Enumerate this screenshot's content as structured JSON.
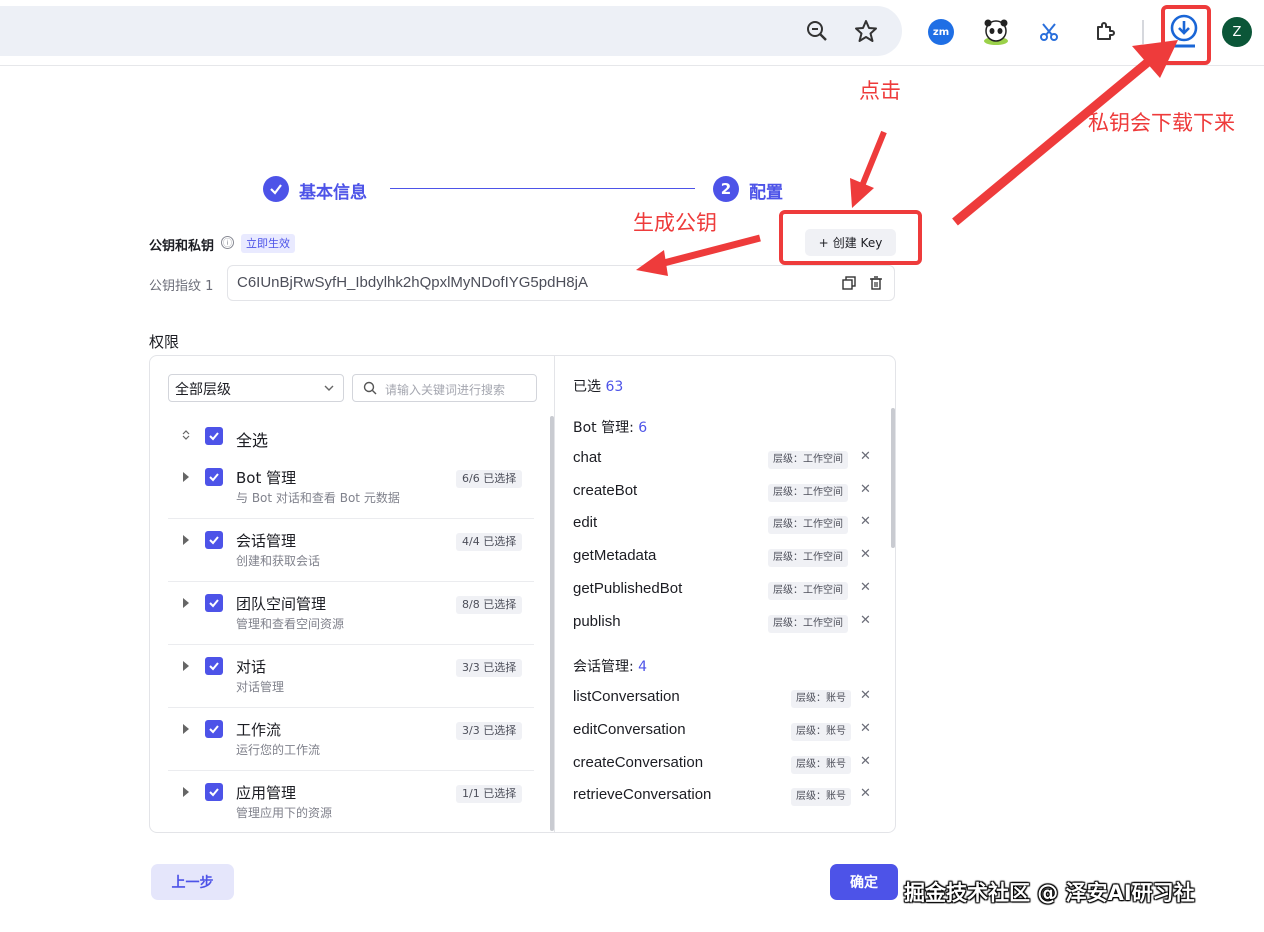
{
  "watermark": "掘金技术社区 @ 泽安AI研习社",
  "browser": {
    "extensions": {
      "zoom_label": "zm"
    },
    "profile_initial": "Z"
  },
  "stepper": {
    "step1_label": "基本信息",
    "step2_number": "2",
    "step2_label": "配置"
  },
  "keys": {
    "section_title": "公钥和私钥",
    "info_icon": "ⓘ",
    "status_badge": "立即生效",
    "create_button": "创建 Key",
    "fingerprint_label": "公钥指纹 1",
    "fingerprint_value": "C6IUnBjRwSyfH_Ibdylhk2hQpxlMyNDofIYG5pdH8jA"
  },
  "permissions": {
    "section_title": "权限",
    "level_select": "全部层级",
    "search_placeholder": "请输入关键词进行搜索",
    "select_all": "全选",
    "categories": [
      {
        "title": "Bot 管理",
        "desc": "与 Bot 对话和查看 Bot 元数据",
        "badge": "6/6 已选择"
      },
      {
        "title": "会话管理",
        "desc": "创建和获取会话",
        "badge": "4/4 已选择"
      },
      {
        "title": "团队空间管理",
        "desc": "管理和查看空间资源",
        "badge": "8/8 已选择"
      },
      {
        "title": "对话",
        "desc": "对话管理",
        "badge": "3/3 已选择"
      },
      {
        "title": "工作流",
        "desc": "运行您的工作流",
        "badge": "3/3 已选择"
      },
      {
        "title": "应用管理",
        "desc": "管理应用下的资源",
        "badge": "1/1 已选择"
      }
    ],
    "selected_label": "已选",
    "selected_count": "63",
    "groups": [
      {
        "title": "Bot 管理:",
        "count": "6",
        "items": [
          {
            "name": "chat",
            "scope": "层级：工作空间"
          },
          {
            "name": "createBot",
            "scope": "层级：工作空间"
          },
          {
            "name": "edit",
            "scope": "层级：工作空间"
          },
          {
            "name": "getMetadata",
            "scope": "层级：工作空间"
          },
          {
            "name": "getPublishedBot",
            "scope": "层级：工作空间"
          },
          {
            "name": "publish",
            "scope": "层级：工作空间"
          }
        ]
      },
      {
        "title": "会话管理:",
        "count": "4",
        "items": [
          {
            "name": "listConversation",
            "scope": "层级：账号"
          },
          {
            "name": "editConversation",
            "scope": "层级：账号"
          },
          {
            "name": "createConversation",
            "scope": "层级：账号"
          },
          {
            "name": "retrieveConversation",
            "scope": "层级：账号"
          }
        ]
      }
    ]
  },
  "footer": {
    "prev_button": "上一步",
    "confirm_button": "确定"
  },
  "annotations": {
    "click": "点击",
    "private_key_download": "私钥会下载下来",
    "generate_public_key": "生成公钥",
    "color": "#ee3b3b"
  },
  "colors": {
    "accent": "#4d53e8",
    "annotation": "#ee3b3b"
  }
}
